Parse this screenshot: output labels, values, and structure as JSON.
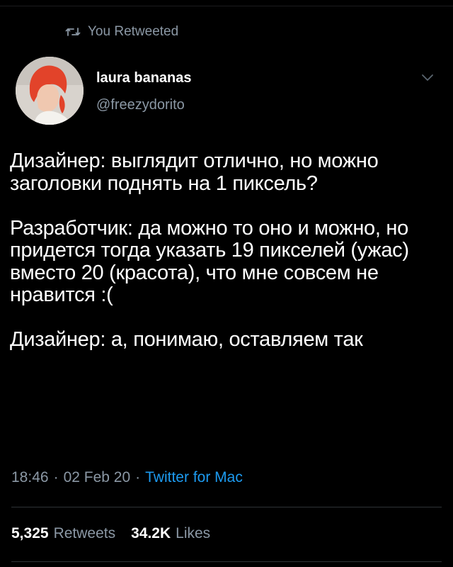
{
  "context": {
    "retweet_label": "You Retweeted",
    "retweet_icon": "retweet-icon"
  },
  "author": {
    "display_name": "laura bananas",
    "handle": "@freezydorito",
    "menu_icon": "chevron-down-icon"
  },
  "tweet": {
    "paragraphs": [
      "Дизайнер: выглядит отлично, но можно заголовки поднять на 1 пиксель?",
      "Разработчик: да можно то оно и можно, но придется тогда указать 19 пикселей (ужас) вместо 20 (красота), что мне совсем не нравится :(",
      "Дизайнер: а, понимаю, оставляем так"
    ]
  },
  "meta": {
    "time": "18:46",
    "separator": "·",
    "date": "02 Feb 20",
    "client": "Twitter for Mac"
  },
  "stats": {
    "retweets_count": "5,325",
    "retweets_label": "Retweets",
    "likes_count": "34.2K",
    "likes_label": "Likes"
  },
  "colors": {
    "background": "#000000",
    "text": "#ffffff",
    "secondary": "#8b98a5",
    "link": "#1d9bf0",
    "divider": "#2f3336"
  }
}
